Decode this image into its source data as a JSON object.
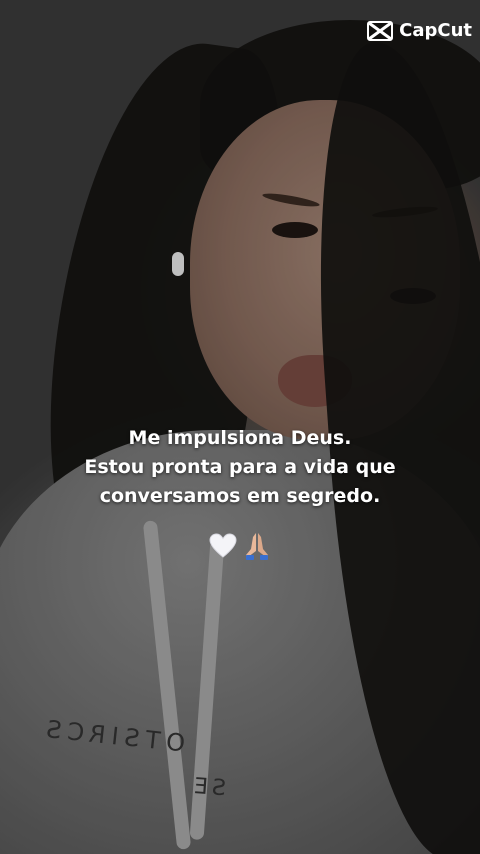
{
  "watermark": {
    "brand": "CapCut",
    "icon": "capcut-logo-icon"
  },
  "caption": {
    "lines": [
      "Me impulsiona Deus.",
      "Estou pronta para a vida que",
      "conversamos em segredo."
    ],
    "emojis": [
      "white-heart-icon",
      "praying-hands-icon"
    ]
  },
  "photo": {
    "hoodie_print": [
      "OTSIRCS",
      "SE"
    ]
  },
  "colors": {
    "caption_text": "#ffffff",
    "background": "#3a3a3a"
  }
}
